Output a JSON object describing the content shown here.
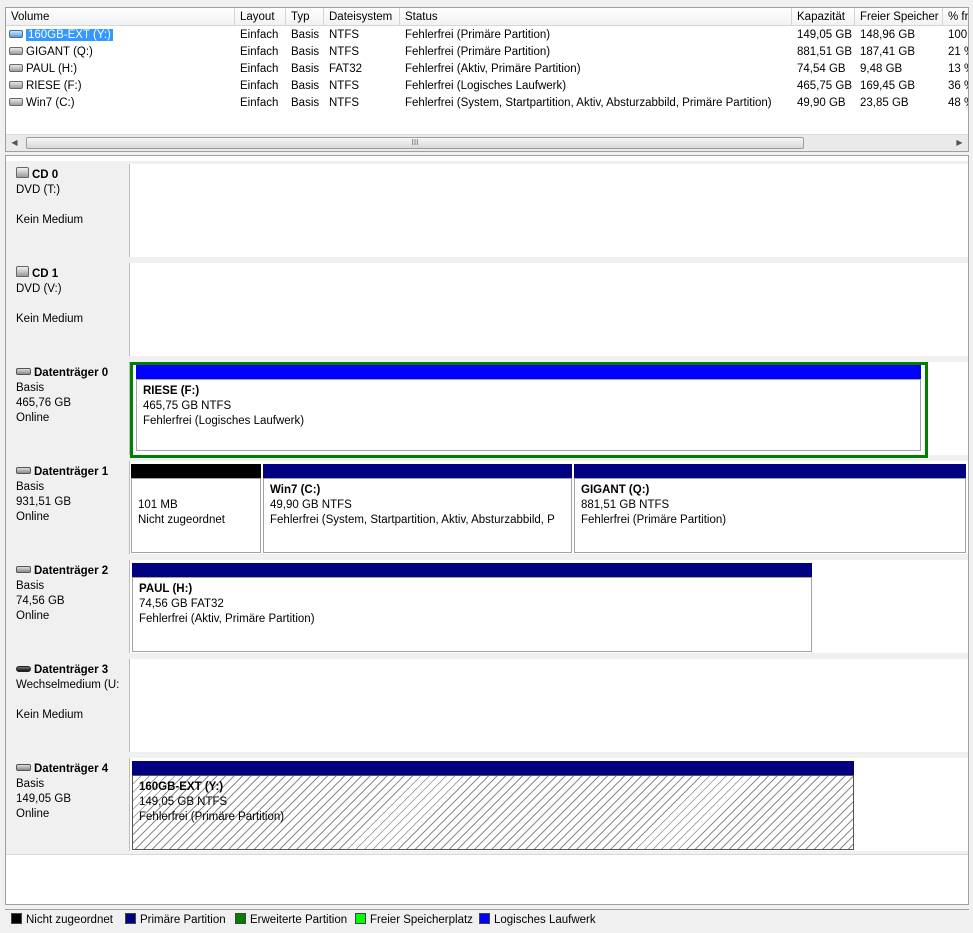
{
  "volume_list": {
    "columns": [
      "Volume",
      "Layout",
      "Typ",
      "Dateisystem",
      "Status",
      "Kapazität",
      "Freier Speicher",
      "% fr"
    ],
    "rows": [
      {
        "volume": "160GB-EXT (Y:)",
        "layout": "Einfach",
        "typ": "Basis",
        "fs": "NTFS",
        "status": "Fehlerfrei (Primäre Partition)",
        "capacity": "149,05 GB",
        "free": "148,96 GB",
        "pct": "100",
        "selected": true
      },
      {
        "volume": "GIGANT (Q:)",
        "layout": "Einfach",
        "typ": "Basis",
        "fs": "NTFS",
        "status": "Fehlerfrei (Primäre Partition)",
        "capacity": "881,51 GB",
        "free": "187,41 GB",
        "pct": "21 %"
      },
      {
        "volume": "PAUL (H:)",
        "layout": "Einfach",
        "typ": "Basis",
        "fs": "FAT32",
        "status": "Fehlerfrei (Aktiv, Primäre Partition)",
        "capacity": "74,54 GB",
        "free": "9,48 GB",
        "pct": "13 %"
      },
      {
        "volume": "RIESE (F:)",
        "layout": "Einfach",
        "typ": "Basis",
        "fs": "NTFS",
        "status": "Fehlerfrei (Logisches Laufwerk)",
        "capacity": "465,75 GB",
        "free": "169,45 GB",
        "pct": "36 %"
      },
      {
        "volume": "Win7 (C:)",
        "layout": "Einfach",
        "typ": "Basis",
        "fs": "NTFS",
        "status": "Fehlerfrei (System, Startpartition, Aktiv, Absturzabbild, Primäre Partition)",
        "capacity": "49,90 GB",
        "free": "23,85 GB",
        "pct": "48 %"
      }
    ],
    "scroll_grip": "III"
  },
  "disks": [
    {
      "name": "CD 0",
      "icon": "cd-icon",
      "lines": [
        "DVD (T:)",
        "",
        "Kein Medium"
      ]
    },
    {
      "name": "CD 1",
      "icon": "cd-icon",
      "lines": [
        "DVD (V:)",
        "",
        "Kein Medium"
      ]
    },
    {
      "name": "Datenträger 0",
      "icon": "hdd-icon",
      "lines": [
        "Basis",
        "465,76 GB",
        "Online"
      ],
      "partitions": [
        {
          "name": "RIESE  (F:)",
          "size": "465,75 GB NTFS",
          "status": "Fehlerfrei (Logisches Laufwerk)"
        }
      ]
    },
    {
      "name": "Datenträger 1",
      "icon": "hdd-icon",
      "lines": [
        "Basis",
        "931,51 GB",
        "Online"
      ],
      "partitions": [
        {
          "name": "",
          "size": "101 MB",
          "status": "Nicht zugeordnet"
        },
        {
          "name": "Win7  (C:)",
          "size": "49,90 GB NTFS",
          "status": "Fehlerfrei (System, Startpartition, Aktiv, Absturzabbild, P"
        },
        {
          "name": "GIGANT  (Q:)",
          "size": "881,51 GB NTFS",
          "status": "Fehlerfrei (Primäre Partition)"
        }
      ]
    },
    {
      "name": "Datenträger 2",
      "icon": "hdd-icon",
      "lines": [
        "Basis",
        "74,56 GB",
        "Online"
      ],
      "partitions": [
        {
          "name": "PAUL  (H:)",
          "size": "74,56 GB FAT32",
          "status": "Fehlerfrei (Aktiv, Primäre Partition)"
        }
      ]
    },
    {
      "name": "Datenträger 3",
      "icon": "removable-icon",
      "lines": [
        "Wechselmedium (U:",
        "",
        "Kein Medium"
      ]
    },
    {
      "name": "Datenträger 4",
      "icon": "hdd-icon",
      "lines": [
        "Basis",
        "149,05 GB",
        "Online"
      ],
      "partitions": [
        {
          "name": "160GB-EXT  (Y:)",
          "size": "149,05 GB NTFS",
          "status": "Fehlerfrei (Primäre Partition)"
        }
      ]
    }
  ],
  "legend": [
    {
      "label": "Nicht zugeordnet",
      "color": "#000000"
    },
    {
      "label": "Primäre Partition",
      "color": "#000080"
    },
    {
      "label": "Erweiterte Partition",
      "color": "#008000"
    },
    {
      "label": "Freier Speicherplatz",
      "color": "#00ff00"
    },
    {
      "label": "Logisches Laufwerk",
      "color": "#0000ff"
    }
  ],
  "colors": {
    "unallocated": "#000000",
    "primary": "#000080",
    "extended": "#008000",
    "logical": "#0000ff",
    "selection": "#3399ff"
  }
}
